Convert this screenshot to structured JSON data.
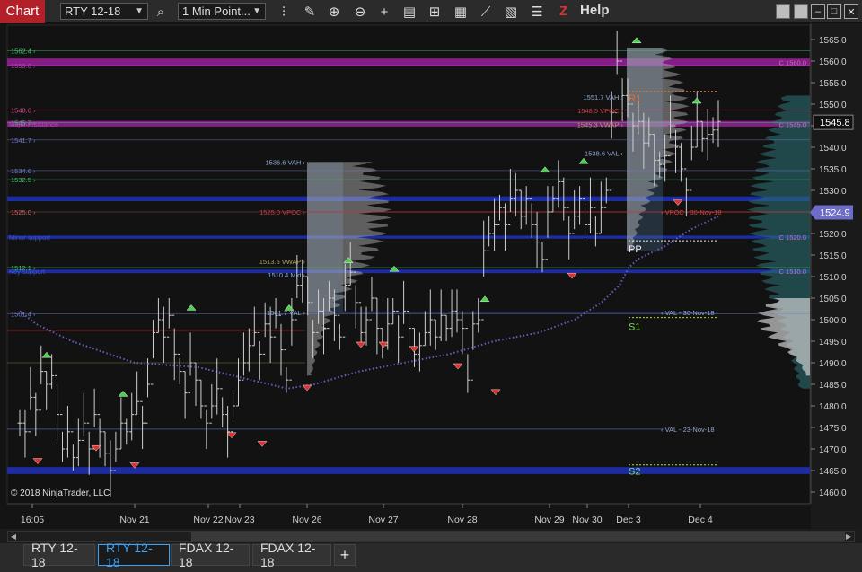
{
  "toolbar": {
    "chart_label": "Chart",
    "instrument": "RTY 12-18",
    "interval": "1 Min Point...",
    "help": "Help",
    "z_logo": "Z",
    "icons": [
      "search-icon",
      "bar-type-icon",
      "draw-pencil-icon",
      "zoom-in-icon",
      "zoom-out-icon",
      "crosshair-icon",
      "data-box-icon",
      "chart-trader-icon",
      "strategies-icon",
      "indicators-icon",
      "properties-icon",
      "templates-icon"
    ]
  },
  "window_buttons": [
    "minimize",
    "restore",
    "maximize",
    "close"
  ],
  "tabs": [
    "RTY 12-18",
    "RTY 12-18",
    "FDAX 12-18",
    "FDAX 12-18"
  ],
  "active_tab": 1,
  "copyright": "© 2018 NinjaTrader, LLC",
  "price_axis": {
    "min": 1460.0,
    "max": 1565.0,
    "step": 5,
    "ticks": [
      "1565.0",
      "1560.0",
      "1555.0",
      "1550.0",
      "1545.0",
      "1540.0",
      "1535.0",
      "1530.0",
      "1525.0",
      "1520.0",
      "1515.0",
      "1510.0",
      "1505.0",
      "1500.0",
      "1495.0",
      "1490.0",
      "1485.0",
      "1480.0",
      "1475.0",
      "1470.0",
      "1465.0",
      "1460.0"
    ],
    "last_price": "1545.8",
    "last_price_color": "#ffffff",
    "second_flag": "1524.9",
    "second_flag_color": "#6d6dc9"
  },
  "time_axis": [
    "16:05",
    "Nov 21",
    "Nov 22",
    "Nov 23",
    "Nov 26",
    "Nov 27",
    "Nov 28",
    "Nov 29",
    "Nov 30",
    "Dec 3",
    "Dec 4"
  ],
  "left_levels": [
    {
      "label": "1562.4",
      "price": 1562.4,
      "color": "#3ec46d"
    },
    {
      "label": "1559.0",
      "price": 1559.0,
      "color": "#c03ec0"
    },
    {
      "label": "1548.6",
      "price": 1548.6,
      "color": "#d0508a"
    },
    {
      "label": "1545.7",
      "price": 1545.7,
      "color": "#3ec46d"
    },
    {
      "label": "1541.7",
      "price": 1541.7,
      "color": "#6d7dd0"
    },
    {
      "label": "1534.6",
      "price": 1534.6,
      "color": "#6d7dd0"
    },
    {
      "label": "1532.5",
      "price": 1532.5,
      "color": "#3ec46d"
    },
    {
      "label": "1525.0",
      "price": 1525.0,
      "color": "#d06060"
    },
    {
      "label": "1512.1",
      "price": 1512.1,
      "color": "#3ec46d"
    },
    {
      "label": "1501.4",
      "price": 1501.4,
      "color": "#6d7dd0"
    }
  ],
  "zone_labels": [
    {
      "label": "Major resistance",
      "color": "#c03ec0"
    },
    {
      "label": "Minor support",
      "color": "#4050d0"
    },
    {
      "label": "Key support",
      "color": "#4050d0"
    }
  ],
  "profile_labels": [
    {
      "label": "1536.6 VAH",
      "color": "#8fa8d8"
    },
    {
      "label": "1525.0 VPOC",
      "color": "#d04040"
    },
    {
      "label": "1513.5 VWAP",
      "color": "#b0a060"
    },
    {
      "label": "1510.4 Mid",
      "color": "#8fa8d8"
    },
    {
      "label": "1501.7 VAL",
      "color": "#8fa8d8"
    },
    {
      "label": "1551.7 VAH",
      "color": "#8fa8d8"
    },
    {
      "label": "1548.5 VPOC",
      "color": "#d04040"
    },
    {
      "label": "1545.3 VWAP",
      "color": "#b0a060"
    },
    {
      "label": "1538.6 VAL",
      "color": "#8fa8d8"
    }
  ],
  "naked_labels": [
    {
      "label": "VPOC - 30-Nov-18",
      "color": "#d04040"
    },
    {
      "label": "VAL - 30-Nov-18",
      "color": "#8fa8d8"
    },
    {
      "label": "VAL - 23-Nov-18",
      "color": "#8fa8d8"
    }
  ],
  "pivot_labels": [
    {
      "label": "R1",
      "color": "#e07030"
    },
    {
      "label": "PP",
      "color": "#f0f0f0"
    },
    {
      "label": "S1",
      "color": "#7ed957"
    },
    {
      "label": "S2",
      "color": "#7ed957"
    }
  ],
  "right_labels": [
    "C 1560.0",
    "C 1545.0",
    "C 1520.0",
    "C 1510.0"
  ],
  "colors": {
    "accent": "#3ea0f0",
    "bar": "#cfcfcf",
    "magenta_zone": "#8b1f8b",
    "blue_zone": "#1f2faa",
    "vwap_dots": "#7060c8",
    "profile": "#bfbfbf",
    "swing_high": "#4fcf4f",
    "swing_low": "#e03030"
  }
}
